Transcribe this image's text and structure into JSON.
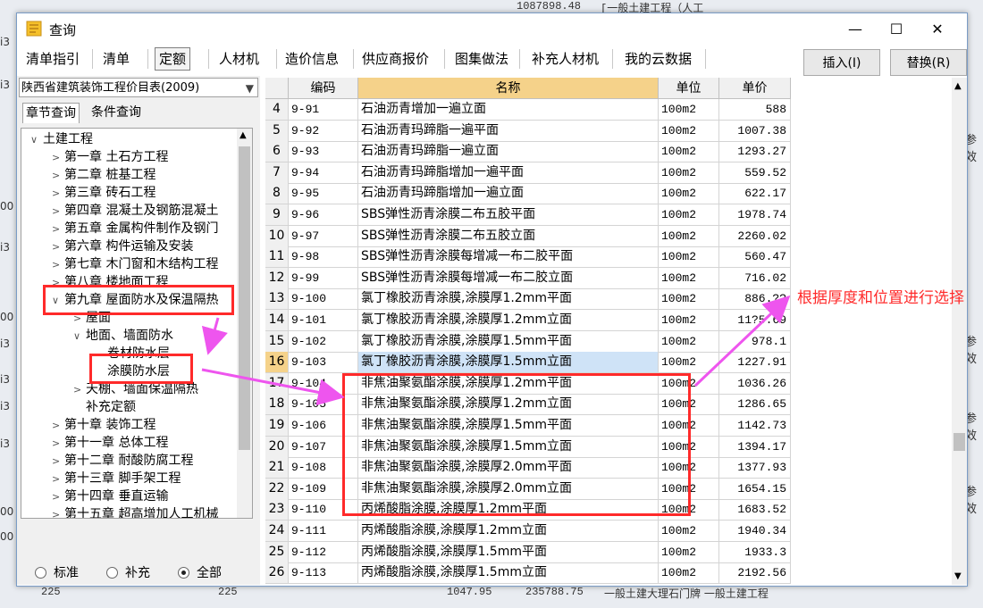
{
  "background": {
    "top_value": "1087898.48",
    "top_label": "[一般土建工程（人工",
    "left_marks": [
      "i3",
      "i3",
      "00",
      "i3",
      "00",
      "i3",
      "i3",
      "i3",
      "i3",
      "00",
      "00"
    ],
    "right_marks": [
      "参效",
      "参效",
      "参效",
      "参效"
    ],
    "bottom_values": [
      "225",
      "225",
      "1047.95",
      "235788.75",
      "一般土建大理石门牌   一般土建工程"
    ]
  },
  "window": {
    "title": "查询",
    "minimize_glyph": "—",
    "maximize_glyph": "☐",
    "close_glyph": "✕",
    "tabs": [
      "清单指引",
      "清单",
      "定额",
      "人材机",
      "造价信息",
      "供应商报价",
      "图集做法",
      "补充人材机",
      "我的云数据"
    ],
    "active_tab": "定额",
    "insert_button": "插入(I)",
    "replace_button": "替换(R)"
  },
  "left_panel": {
    "library": "陕西省建筑装饰工程价目表(2009)",
    "subtabs": [
      "章节查询",
      "条件查询"
    ],
    "tree": [
      {
        "label": "土建工程",
        "chev": "∨",
        "level": 0
      },
      {
        "label": "第一章  土石方工程",
        "chev": ">",
        "level": 1
      },
      {
        "label": "第二章  桩基工程",
        "chev": ">",
        "level": 1
      },
      {
        "label": "第三章  砖石工程",
        "chev": ">",
        "level": 1
      },
      {
        "label": "第四章  混凝土及钢筋混凝土",
        "chev": ">",
        "level": 1
      },
      {
        "label": "第五章  金属构件制作及钢门",
        "chev": ">",
        "level": 1
      },
      {
        "label": "第六章  构件运输及安装",
        "chev": ">",
        "level": 1
      },
      {
        "label": "第七章  木门窗和木结构工程",
        "chev": ">",
        "level": 1
      },
      {
        "label": "第八章  楼地面工程",
        "chev": ">",
        "level": 1
      },
      {
        "label": "第九章  屋面防水及保温隔热",
        "chev": "∨",
        "level": 1
      },
      {
        "label": "屋面",
        "chev": ">",
        "level": 2
      },
      {
        "label": "地面、墙面防水",
        "chev": "∨",
        "level": 2
      },
      {
        "label": "卷材防水层",
        "chev": "",
        "level": 3
      },
      {
        "label": "涂膜防水层",
        "chev": "",
        "level": 3
      },
      {
        "label": "天棚、墙面保温隔热",
        "chev": ">",
        "level": 2
      },
      {
        "label": "补充定额",
        "chev": "",
        "level": 2
      },
      {
        "label": "第十章  装饰工程",
        "chev": ">",
        "level": 1
      },
      {
        "label": "第十一章  总体工程",
        "chev": ">",
        "level": 1
      },
      {
        "label": "第十二章  耐酸防腐工程",
        "chev": ">",
        "level": 1
      },
      {
        "label": "第十三章  脚手架工程",
        "chev": ">",
        "level": 1
      },
      {
        "label": "第十四章  垂直运输",
        "chev": ">",
        "level": 1
      },
      {
        "label": "第十五章  超高增加人工机械",
        "chev": ">",
        "level": 1
      }
    ],
    "radios": [
      "标准",
      "补充",
      "全部"
    ],
    "selected_radio": "全部"
  },
  "grid": {
    "columns": [
      "",
      "编码",
      "名称",
      "单位",
      "单价"
    ],
    "rows": [
      {
        "no": "4",
        "code": "9-91",
        "name": "石油沥青增加一遍立面",
        "unit": "100m2",
        "price": "588"
      },
      {
        "no": "5",
        "code": "9-92",
        "name": "石油沥青玛蹄脂一遍平面",
        "unit": "100m2",
        "price": "1007.38"
      },
      {
        "no": "6",
        "code": "9-93",
        "name": "石油沥青玛蹄脂一遍立面",
        "unit": "100m2",
        "price": "1293.27"
      },
      {
        "no": "7",
        "code": "9-94",
        "name": "石油沥青玛蹄脂增加一遍平面",
        "unit": "100m2",
        "price": "559.52"
      },
      {
        "no": "8",
        "code": "9-95",
        "name": "石油沥青玛蹄脂增加一遍立面",
        "unit": "100m2",
        "price": "622.17"
      },
      {
        "no": "9",
        "code": "9-96",
        "name": "SBS弹性沥青涂膜二布五胶平面",
        "unit": "100m2",
        "price": "1978.74"
      },
      {
        "no": "10",
        "code": "9-97",
        "name": "SBS弹性沥青涂膜二布五胶立面",
        "unit": "100m2",
        "price": "2260.02"
      },
      {
        "no": "11",
        "code": "9-98",
        "name": "SBS弹性沥青涂膜每增减一布二胶平面",
        "unit": "100m2",
        "price": "560.47"
      },
      {
        "no": "12",
        "code": "9-99",
        "name": "SBS弹性沥青涂膜每增减一布二胶立面",
        "unit": "100m2",
        "price": "716.02"
      },
      {
        "no": "13",
        "code": "9-100",
        "name": "氯丁橡胶沥青涂膜,涂膜厚1.2mm平面",
        "unit": "100m2",
        "price": "886.??"
      },
      {
        "no": "14",
        "code": "9-101",
        "name": "氯丁橡胶沥青涂膜,涂膜厚1.2mm立面",
        "unit": "100m2",
        "price": "11?5.69"
      },
      {
        "no": "15",
        "code": "9-102",
        "name": "氯丁橡胶沥青涂膜,涂膜厚1.5mm平面",
        "unit": "100m2",
        "price": "978.1"
      },
      {
        "no": "16",
        "code": "9-103",
        "name": "氯丁橡胶沥青涂膜,涂膜厚1.5mm立面",
        "unit": "100m2",
        "price": "1227.91"
      },
      {
        "no": "17",
        "code": "9-104",
        "name": "非焦油聚氨酯涂膜,涂膜厚1.2mm平面",
        "unit": "100m2",
        "price": "1036.26"
      },
      {
        "no": "18",
        "code": "9-105",
        "name": "非焦油聚氨酯涂膜,涂膜厚1.2mm立面",
        "unit": "100m2",
        "price": "1286.65"
      },
      {
        "no": "19",
        "code": "9-106",
        "name": "非焦油聚氨酯涂膜,涂膜厚1.5mm平面",
        "unit": "100m2",
        "price": "1142.73"
      },
      {
        "no": "20",
        "code": "9-107",
        "name": "非焦油聚氨酯涂膜,涂膜厚1.5mm立面",
        "unit": "100m2",
        "price": "1394.17"
      },
      {
        "no": "21",
        "code": "9-108",
        "name": "非焦油聚氨酯涂膜,涂膜厚2.0mm平面",
        "unit": "100m2",
        "price": "1377.93"
      },
      {
        "no": "22",
        "code": "9-109",
        "name": "非焦油聚氨酯涂膜,涂膜厚2.0mm立面",
        "unit": "100m2",
        "price": "1654.15"
      },
      {
        "no": "23",
        "code": "9-110",
        "name": "丙烯酸脂涂膜,涂膜厚1.2mm平面",
        "unit": "100m2",
        "price": "1683.52"
      },
      {
        "no": "24",
        "code": "9-111",
        "name": "丙烯酸脂涂膜,涂膜厚1.2mm立面",
        "unit": "100m2",
        "price": "1940.34"
      },
      {
        "no": "25",
        "code": "9-112",
        "name": "丙烯酸脂涂膜,涂膜厚1.5mm平面",
        "unit": "100m2",
        "price": "1933.3"
      },
      {
        "no": "26",
        "code": "9-113",
        "name": "丙烯酸脂涂膜,涂膜厚1.5mm立面",
        "unit": "100m2",
        "price": "2192.56"
      }
    ],
    "selected_row": "16"
  },
  "annotation": {
    "text": "根据厚度和位置进行选择",
    "color": "#ff2a2a"
  }
}
